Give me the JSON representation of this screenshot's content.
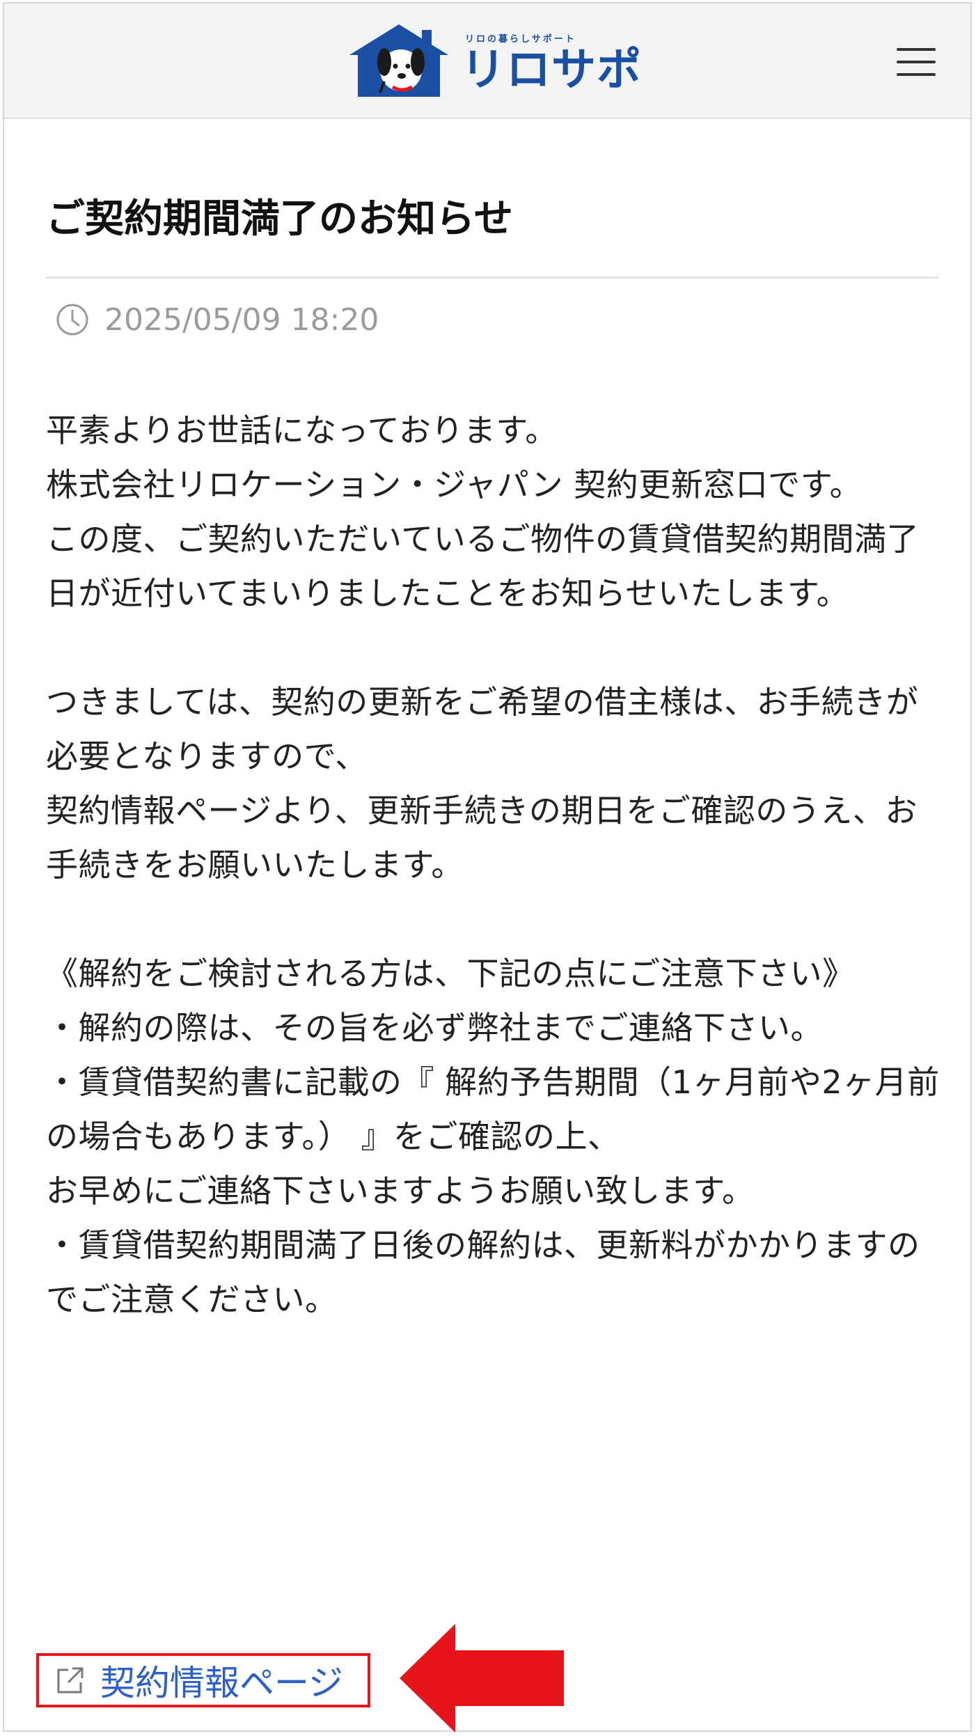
{
  "header": {
    "logo_tagline": "リロの暮らしサポート",
    "logo_text": "リロサポ",
    "menu_icon": "hamburger-menu-icon"
  },
  "notice": {
    "title": "ご契約期間満了のお知らせ",
    "datetime": "2025/05/09 18:20",
    "clock_icon": "clock-icon",
    "body": "平素よりお世話になっております。\n株式会社リロケーション・ジャパン 契約更新窓口です。\nこの度、ご契約いただいているご物件の賃貸借契約期間満了日が近付いてまいりましたことをお知らせいたします。\n\nつきましては、契約の更新をご希望の借主様は、お手続きが必要となりますので、\n契約情報ページより、更新手続きの期日をご確認のうえ、お手続きをお願いいたします。\n\n《解約をご検討される方は、下記の点にご注意下さい》\n・解約の際は、その旨を必ず弊社までご連絡下さい。\n・賃貸借契約書に記載の『 解約予告期間（1ヶ月前や2ヶ月前の場合もあります。） 』をご確認の上、\nお早めにご連絡下さいますようお願い致します。\n・賃貸借契約期間満了日後の解約は、更新料がかかりますのでご注意ください。"
  },
  "link": {
    "label": "契約情報ページ",
    "icon": "external-link-icon"
  },
  "annotation": {
    "arrow_color": "#e8141c",
    "highlight_color": "#e8141c"
  },
  "colors": {
    "brand": "#1a4fa3",
    "link": "#2c5fc7",
    "meta": "#9b9b9b"
  }
}
